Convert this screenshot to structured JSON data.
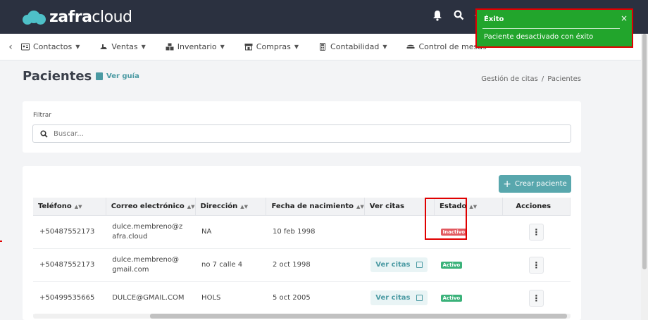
{
  "app": {
    "brand_strong": "zafra",
    "brand_light": "cloud"
  },
  "menu": {
    "items": [
      {
        "label": "Contactos",
        "icon": "contacts-icon"
      },
      {
        "label": "Ventas",
        "icon": "sales-icon"
      },
      {
        "label": "Inventario",
        "icon": "inventory-icon"
      },
      {
        "label": "Compras",
        "icon": "store-icon"
      },
      {
        "label": "Contabilidad",
        "icon": "calculator-icon"
      },
      {
        "label": "Control de mesas",
        "icon": "tables-icon"
      }
    ]
  },
  "page": {
    "title": "Pacientes",
    "guide_label": "Ver guía",
    "breadcrumb": [
      "Gestión de citas",
      "/",
      "Pacientes"
    ]
  },
  "filter": {
    "label": "Filtrar",
    "placeholder": "Buscar..."
  },
  "table": {
    "create_button": "Crear paciente",
    "columns": [
      "Teléfono",
      "Correo electrónico",
      "Dirección",
      "Fecha de nacimiento",
      "Ver citas",
      "Estado",
      "Acciones"
    ],
    "rows": [
      {
        "phone": "+50487552173",
        "email_1": "dulce.membreno@z",
        "email_2": "afra.cloud",
        "address": "NA",
        "birth": "10 feb 1998",
        "citas": "",
        "status": "Inactivo"
      },
      {
        "phone": "+50487552173",
        "email_1": "dulce.membreno@",
        "email_2": "gmail.com",
        "address": "no 7 calle 4",
        "birth": "2 oct 1998",
        "citas": "Ver citas",
        "status": "Activo"
      },
      {
        "phone": "+50499535665",
        "email_1": "DULCE@GMAIL.COM",
        "email_2": "",
        "address": "HOLS",
        "birth": "5 oct 2005",
        "citas": "Ver citas",
        "status": "Activo"
      }
    ]
  },
  "toast": {
    "title": "Éxito",
    "message": "Paciente desactivado con éxito",
    "close": "×"
  },
  "colors": {
    "accent": "#4b9aa3",
    "topbar": "#2b3140",
    "toast": "#22a52c",
    "inactive": "#e25a60",
    "active": "#3bb27a"
  }
}
